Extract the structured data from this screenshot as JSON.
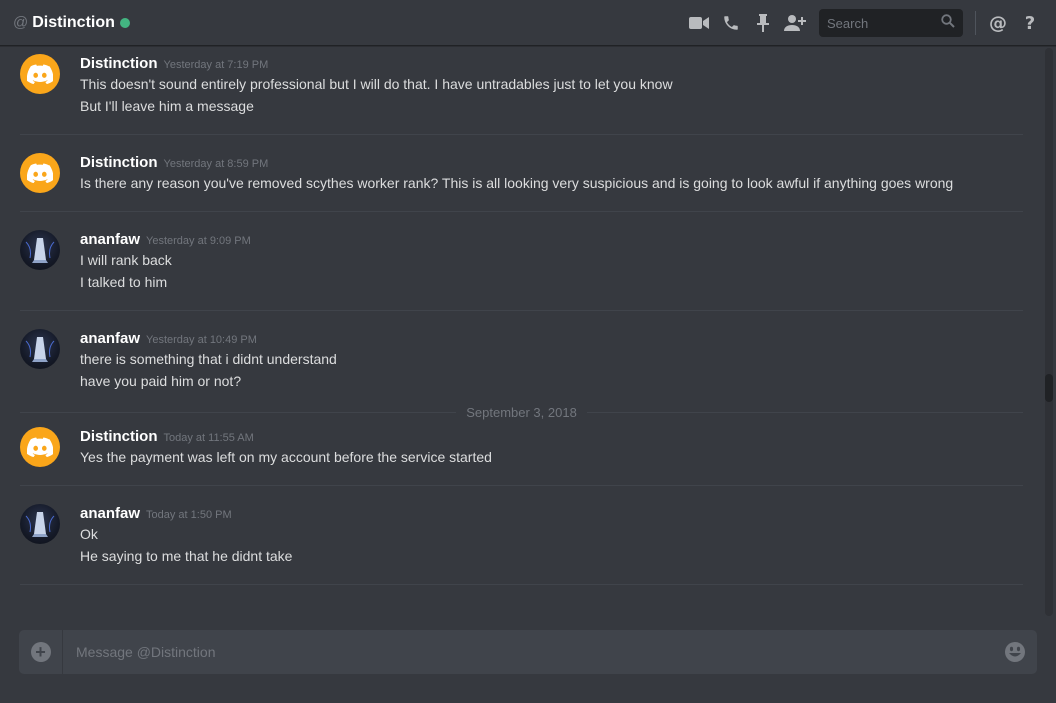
{
  "header": {
    "at_symbol": "@",
    "channel_name": "Distinction",
    "status_color": "#43b581",
    "search_placeholder": "Search",
    "icons": [
      "video-call-icon",
      "voice-call-icon",
      "pin-icon",
      "add-friend-icon",
      "search-icon",
      "mention-icon",
      "help-icon"
    ]
  },
  "messages": [
    {
      "author": "Distinction",
      "avatar": "discord-logo",
      "timestamp": "Yesterday at 7:19 PM",
      "lines": [
        "This doesn't sound entirely professional but I will do that. I have untradables just to let you know",
        "But I'll leave him a message"
      ]
    },
    {
      "author": "Distinction",
      "avatar": "discord-logo",
      "timestamp": "Yesterday at 8:59 PM",
      "lines": [
        "Is there any reason you've removed scythes worker rank? This is all looking very suspicious and is going to look awful if anything goes wrong"
      ]
    },
    {
      "author": "ananfaw",
      "avatar": "custom-avatar",
      "timestamp": "Yesterday at 9:09 PM",
      "lines": [
        "I will rank back",
        "I talked to him"
      ]
    },
    {
      "author": "ananfaw",
      "avatar": "custom-avatar",
      "timestamp": "Yesterday at 10:49 PM",
      "lines": [
        "there is something that i didnt understand",
        "have you paid him or not?"
      ]
    }
  ],
  "date_divider": "September 3, 2018",
  "messages_after": [
    {
      "author": "Distinction",
      "avatar": "discord-logo",
      "timestamp": "Today at 11:55 AM",
      "lines": [
        "Yes the payment was left on my account before the service started"
      ]
    },
    {
      "author": "ananfaw",
      "avatar": "custom-avatar",
      "timestamp": "Today at 1:50 PM",
      "lines": [
        "Ok",
        "He saying to me that he didnt take"
      ]
    }
  ],
  "composer": {
    "placeholder": "Message @Distinction",
    "upload_symbol": "+",
    "icons": [
      "upload-icon",
      "emoji-icon"
    ]
  },
  "colors": {
    "background": "#36393f",
    "accent_discord_avatar": "#faa61a",
    "username": "#ffffff",
    "timestamp": "#72767d"
  }
}
